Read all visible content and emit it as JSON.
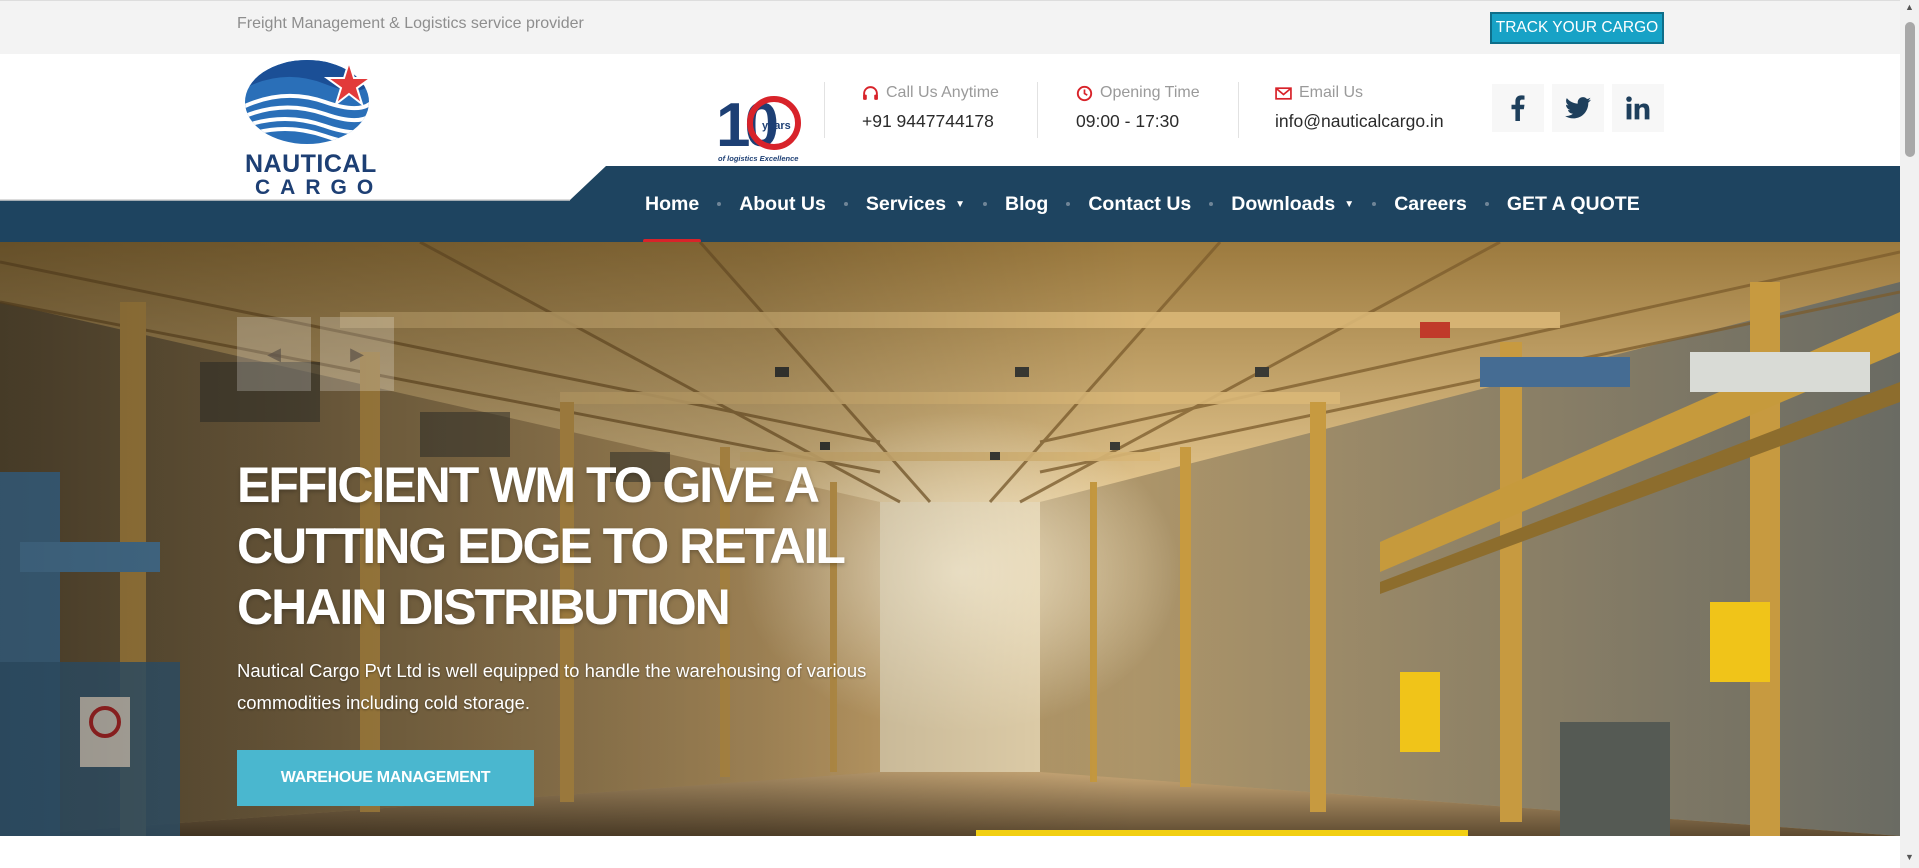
{
  "topbar": {
    "tagline": "Freight Management & Logistics service provider",
    "track_button": "TRACK YOUR CARGO"
  },
  "logo": {
    "line1": "NAUTICAL",
    "line2": "CARGO"
  },
  "badge": {
    "number": "10",
    "years": "years",
    "caption": "of logistics Excellence"
  },
  "contacts": [
    {
      "label": "Call Us Anytime",
      "value": "+91 9447744178",
      "icon": "headset-icon"
    },
    {
      "label": "Opening Time",
      "value": "09:00 - 17:30",
      "icon": "clock-icon"
    },
    {
      "label": "Email Us",
      "value": "info@nauticalcargo.in",
      "icon": "envelope-icon"
    }
  ],
  "social": [
    {
      "glyph": "f",
      "icon": "facebook-icon"
    },
    {
      "glyph": "t",
      "icon": "twitter-icon"
    },
    {
      "glyph": "in",
      "icon": "linkedin-icon"
    }
  ],
  "nav": {
    "items": [
      {
        "label": "Home",
        "active": true
      },
      {
        "label": "About Us"
      },
      {
        "label": "Services",
        "dropdown": true
      },
      {
        "label": "Blog"
      },
      {
        "label": "Contact Us"
      },
      {
        "label": "Downloads",
        "dropdown": true
      },
      {
        "label": "Careers"
      },
      {
        "label": "GET A QUOTE"
      }
    ]
  },
  "hero": {
    "title_lines": [
      "EFFICIENT WM TO GIVE A",
      "CUTTING EDGE TO RETAIL",
      "CHAIN DISTRIBUTION"
    ],
    "description": "Nautical Cargo Pvt Ltd is well equipped to handle the warehousing of various commodities including cold storage.",
    "button": "WAREHOUE MANAGEMENT"
  },
  "colors": {
    "nav_bg": "#1e4460",
    "accent_red": "#d8232a",
    "track_btn": "#17a2c6",
    "hero_btn": "#4ab7cf"
  }
}
